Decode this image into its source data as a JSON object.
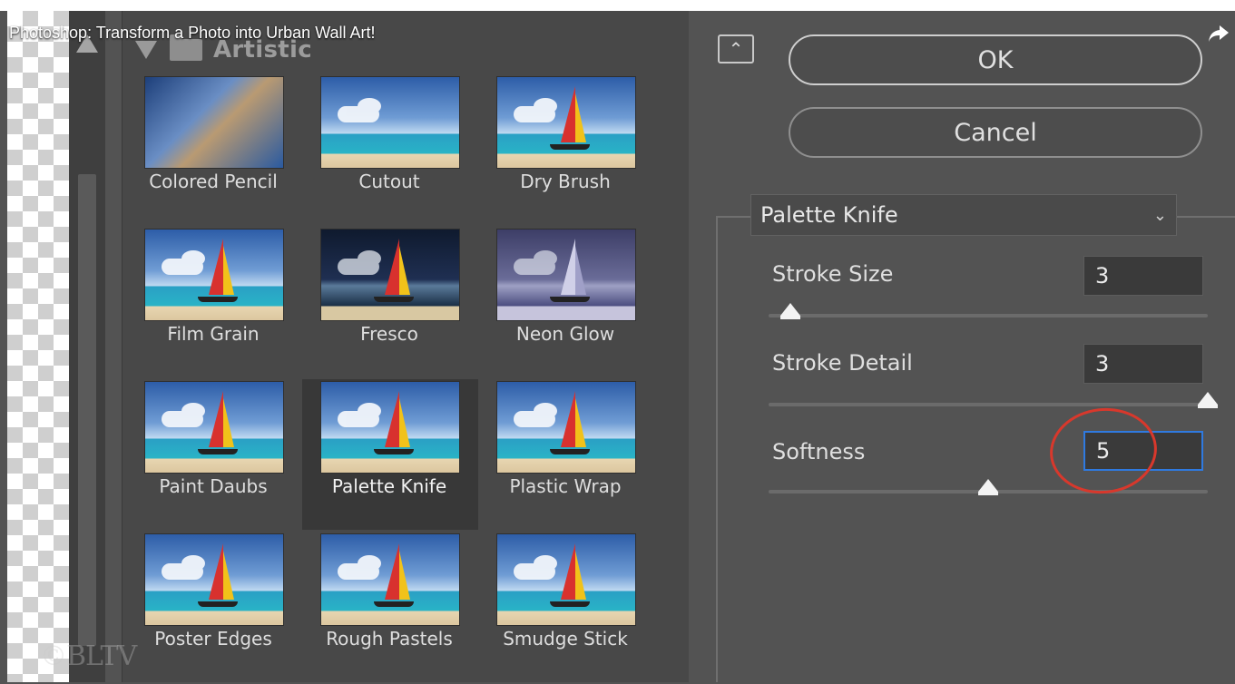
{
  "video": {
    "title": "Photoshop: Transform a Photo into Urban Wall Art!"
  },
  "gallery": {
    "category": "Artistic",
    "thumbnails": [
      {
        "label": "Colored Pencil"
      },
      {
        "label": "Cutout"
      },
      {
        "label": "Dry Brush"
      },
      {
        "label": "Film Grain"
      },
      {
        "label": "Fresco"
      },
      {
        "label": "Neon Glow"
      },
      {
        "label": "Paint Daubs"
      },
      {
        "label": "Palette Knife",
        "selected": true
      },
      {
        "label": "Plastic Wrap"
      },
      {
        "label": "Poster Edges"
      },
      {
        "label": "Rough Pastels"
      },
      {
        "label": "Smudge Stick"
      }
    ]
  },
  "dialog": {
    "ok_label": "OK",
    "cancel_label": "Cancel",
    "filter_select": "Palette Knife",
    "params": [
      {
        "label": "Stroke Size",
        "value": "3",
        "slider_fraction": 0.05
      },
      {
        "label": "Stroke Detail",
        "value": "3",
        "slider_fraction": 1.0
      },
      {
        "label": "Softness",
        "value": "5",
        "slider_fraction": 0.5
      }
    ]
  },
  "watermark": "©BLTV",
  "colors": {
    "focus_border": "#2f7ae0",
    "annotation_circle": "#d8382c"
  }
}
